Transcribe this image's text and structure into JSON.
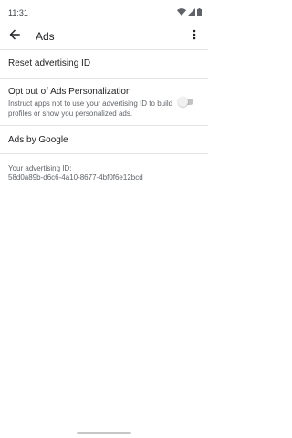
{
  "status_bar": {
    "time": "11:31",
    "icons": [
      "wifi-icon",
      "signal-icon",
      "battery-icon"
    ]
  },
  "app_bar": {
    "title": "Ads",
    "back_icon": "back-arrow-icon",
    "menu_icon": "more-vert-icon"
  },
  "items": {
    "reset": {
      "title": "Reset advertising ID"
    },
    "opt_out": {
      "title": "Opt out of Ads Personalization",
      "summary": "Instruct apps not to use your advertising ID to build profiles or show you personalized ads.",
      "enabled": false
    },
    "ads_by_google": {
      "title": "Ads by Google"
    }
  },
  "advertising_id": {
    "label": "Your advertising ID:",
    "value": "58d0a89b-d6c6-4a10-8677-4bf0f6e12bcd"
  },
  "colors": {
    "text_primary": "#202124",
    "text_secondary": "#5f6368",
    "divider": "#e3e3e3",
    "toggle_off_track": "#c4c4c4"
  }
}
